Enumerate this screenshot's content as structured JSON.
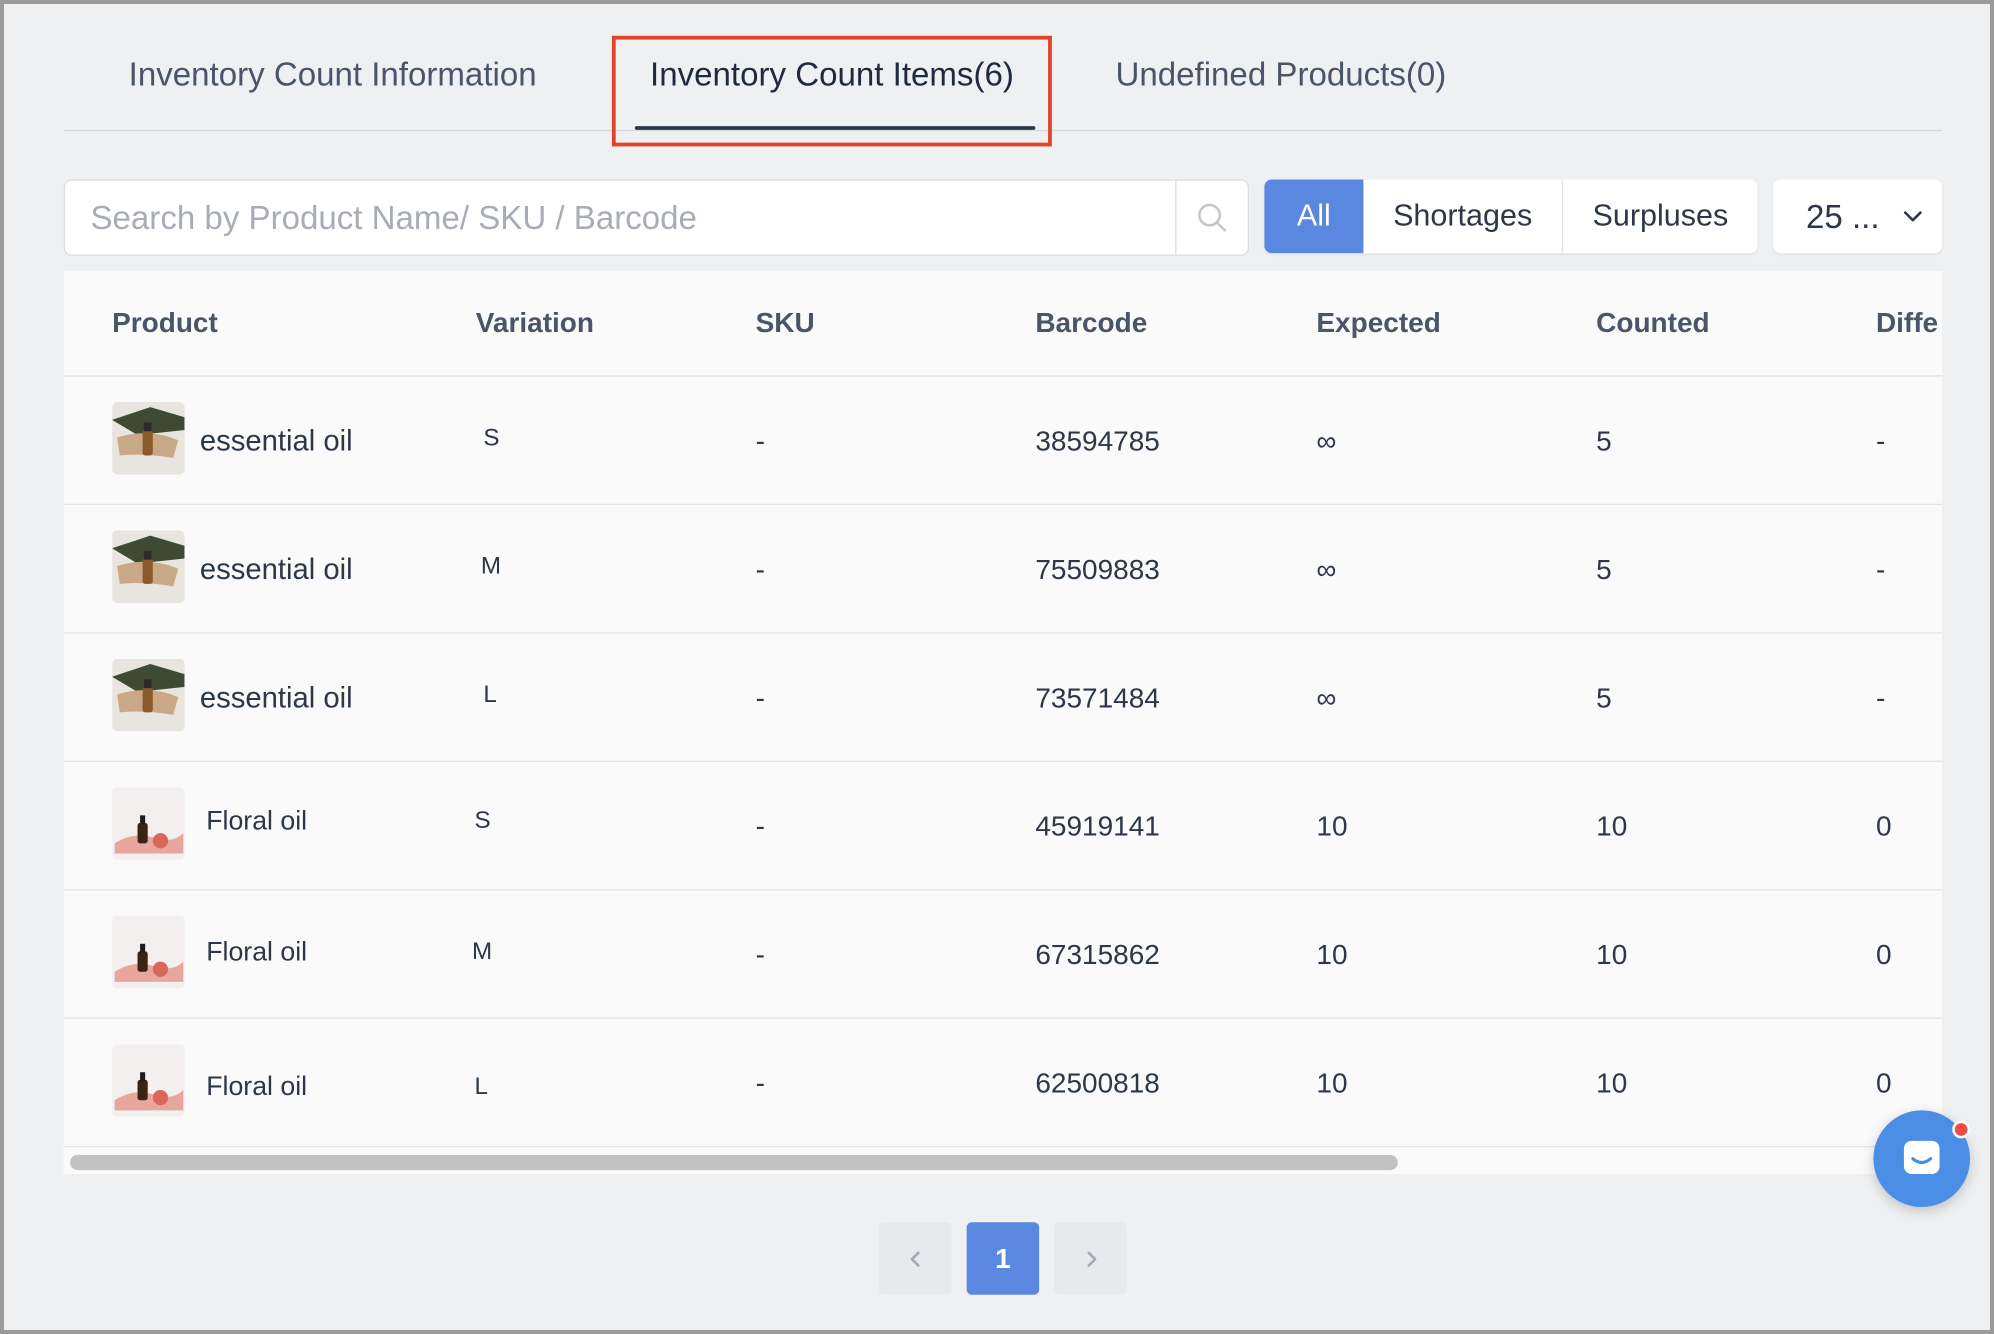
{
  "tabs": [
    {
      "label": "Inventory Count Information"
    },
    {
      "label": "Inventory Count Items(6)"
    },
    {
      "label": "Undefined Products(0)"
    }
  ],
  "search": {
    "placeholder": "Search by Product Name/ SKU / Barcode",
    "icon": "search-icon"
  },
  "filters": {
    "all": "All",
    "shortages": "Shortages",
    "surpluses": "Surpluses"
  },
  "page_size": {
    "value": "25 ...",
    "icon": "chevron-down-icon"
  },
  "table": {
    "headers": {
      "product": "Product",
      "variation": "Variation",
      "sku": "SKU",
      "barcode": "Barcode",
      "expected": "Expected",
      "counted": "Counted",
      "difference": "Diffe"
    },
    "rows": [
      {
        "product": "essential oil",
        "variation": "S",
        "sku": "-",
        "barcode": "38594785",
        "expected": "∞",
        "counted": "5",
        "difference": "-"
      },
      {
        "product": "essential oil",
        "variation": "M",
        "sku": "-",
        "barcode": "75509883",
        "expected": "∞",
        "counted": "5",
        "difference": "-"
      },
      {
        "product": "essential oil",
        "variation": "L",
        "sku": "-",
        "barcode": "73571484",
        "expected": "∞",
        "counted": "5",
        "difference": "-"
      },
      {
        "product": "Floral oil",
        "variation": "S",
        "sku": "-",
        "barcode": "45919141",
        "expected": "10",
        "counted": "10",
        "difference": "0"
      },
      {
        "product": "Floral oil",
        "variation": "M",
        "sku": "-",
        "barcode": "67315862",
        "expected": "10",
        "counted": "10",
        "difference": "0"
      },
      {
        "product": "Floral oil",
        "variation": "L",
        "sku": "-",
        "barcode": "62500818",
        "expected": "10",
        "counted": "10",
        "difference": "0"
      }
    ]
  },
  "pagination": {
    "current": "1"
  },
  "colors": {
    "accent": "#5a87e0",
    "highlight": "#e0442b",
    "chat": "#4a8ee6"
  }
}
